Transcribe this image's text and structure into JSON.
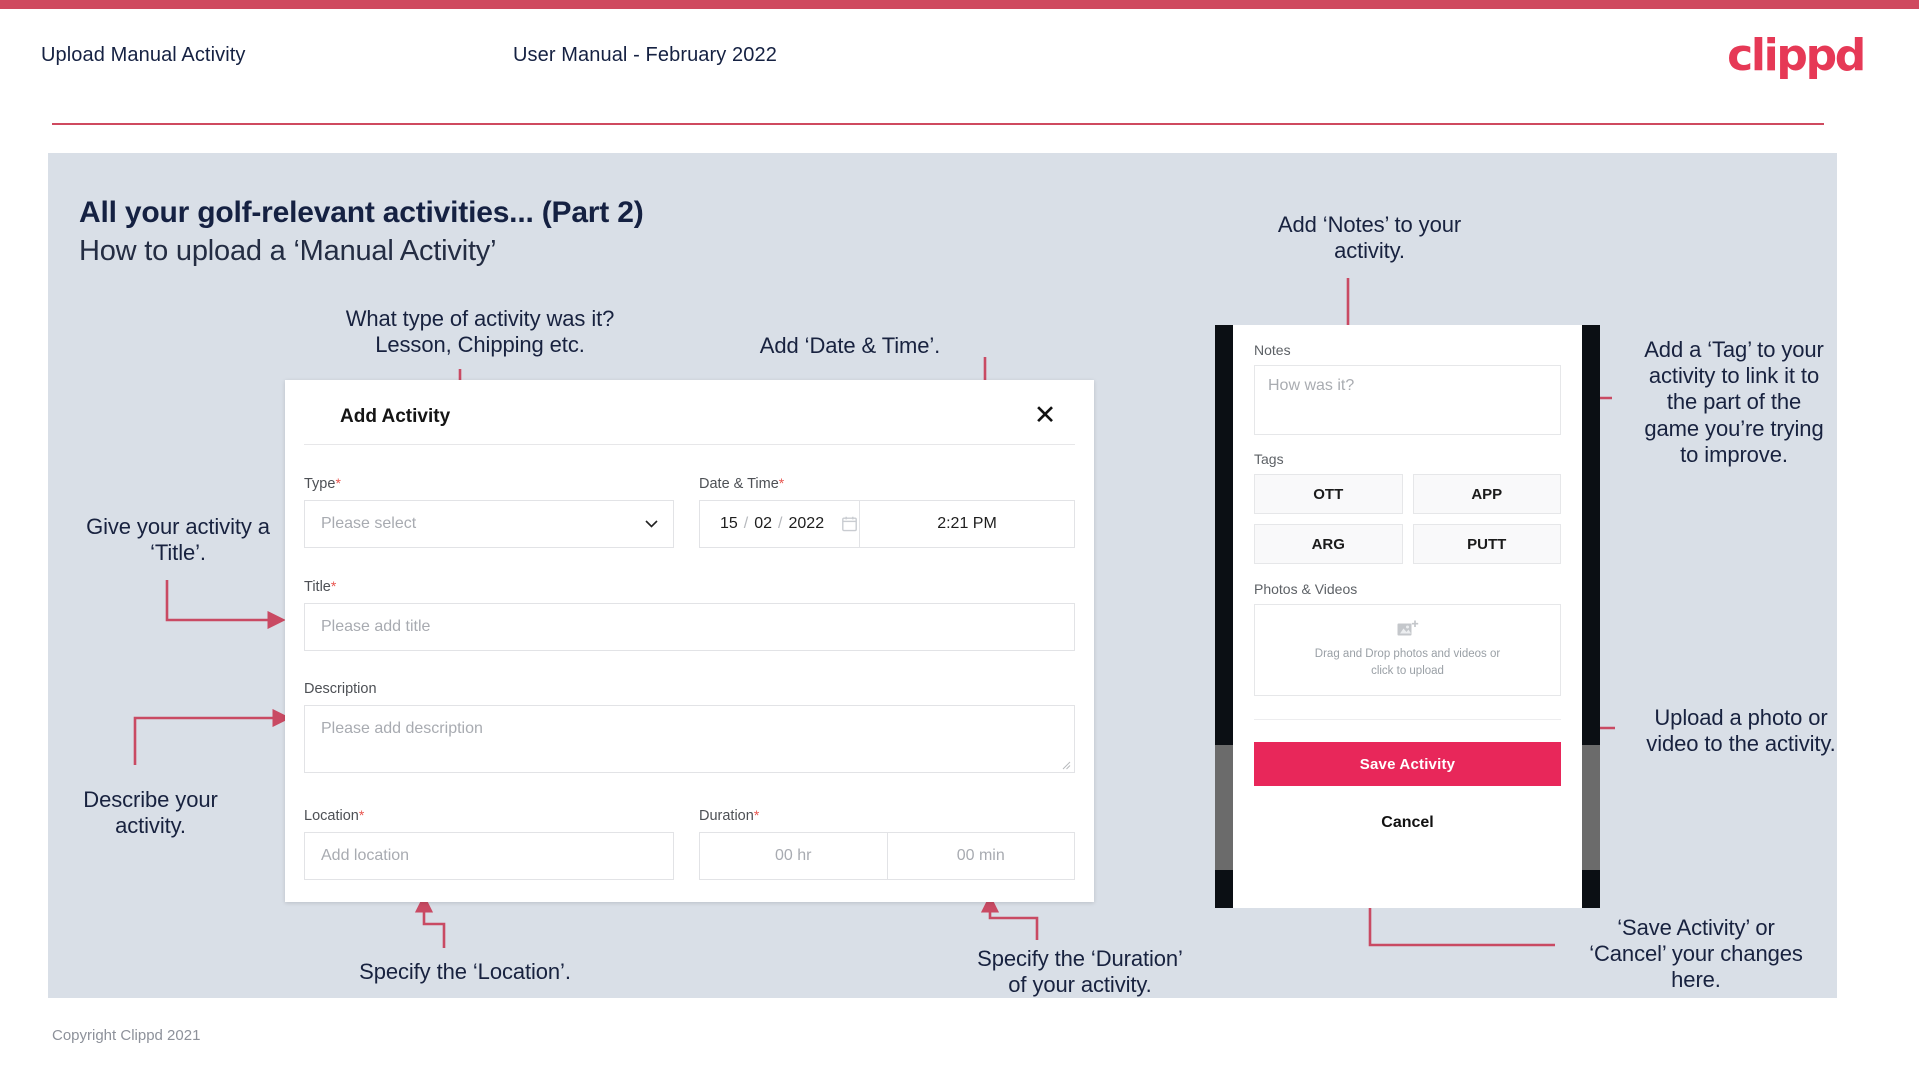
{
  "header": {
    "title": "Upload Manual Activity",
    "subtitle": "User Manual - February 2022",
    "logo": "clippd"
  },
  "slide": {
    "title": "All your golf-relevant activities... (Part 2)",
    "subtitle": "How to upload a ‘Manual Activity’",
    "copyright": "Copyright Clippd 2021"
  },
  "dialog": {
    "title": "Add Activity",
    "close_icon": "close-icon",
    "fields": {
      "type": {
        "label": "Type",
        "required": "*",
        "placeholder": "Please select"
      },
      "datetime": {
        "label": "Date & Time",
        "required": "*",
        "day": "15",
        "month": "02",
        "year": "2022",
        "sep": "/",
        "time": "2:21 PM"
      },
      "title": {
        "label": "Title",
        "required": "*",
        "placeholder": "Please add title"
      },
      "description": {
        "label": "Description",
        "placeholder": "Please add description"
      },
      "location": {
        "label": "Location",
        "required": "*",
        "placeholder": "Add location"
      },
      "duration": {
        "label": "Duration",
        "required": "*",
        "hours": "00 hr",
        "minutes": "00 min"
      }
    }
  },
  "phone": {
    "notes": {
      "label": "Notes",
      "placeholder": "How was it?"
    },
    "tags": {
      "label": "Tags",
      "options": [
        "OTT",
        "APP",
        "ARG",
        "PUTT"
      ]
    },
    "photos": {
      "label": "Photos & Videos",
      "dropzone_line1": "Drag and Drop photos and videos or",
      "dropzone_line2": "click to upload"
    },
    "save_label": "Save Activity",
    "cancel_label": "Cancel"
  },
  "annotations": [
    {
      "id": "type",
      "lines": [
        "What type of activity was it?",
        "Lesson, Chipping etc."
      ]
    },
    {
      "id": "datetime",
      "lines": [
        "Add ‘Date & Time’."
      ]
    },
    {
      "id": "title",
      "lines": [
        "Give your activity a",
        "‘Title’."
      ]
    },
    {
      "id": "describe",
      "lines": [
        "Describe your",
        "activity."
      ]
    },
    {
      "id": "location",
      "lines": [
        "Specify the ‘Location’."
      ]
    },
    {
      "id": "duration",
      "lines": [
        "Specify the ‘Duration’",
        "of your activity."
      ]
    },
    {
      "id": "notes",
      "lines": [
        "Add ‘Notes’ to your",
        "activity."
      ]
    },
    {
      "id": "tag",
      "lines": [
        "Add a ‘Tag’ to your",
        "activity to link it to",
        "the part of the",
        "game you’re trying",
        "to improve."
      ]
    },
    {
      "id": "upload",
      "lines": [
        "Upload a photo or",
        "video to the activity."
      ]
    },
    {
      "id": "savecancel",
      "lines": [
        "‘Save Activity’ or",
        "‘Cancel’ your changes",
        "here."
      ]
    }
  ],
  "colors": {
    "accent": "#e8275a",
    "header_rule": "#cf4a5f",
    "arrow": "#c94a63",
    "slide_bg": "#d9dfe7",
    "text_dark": "#152142"
  }
}
